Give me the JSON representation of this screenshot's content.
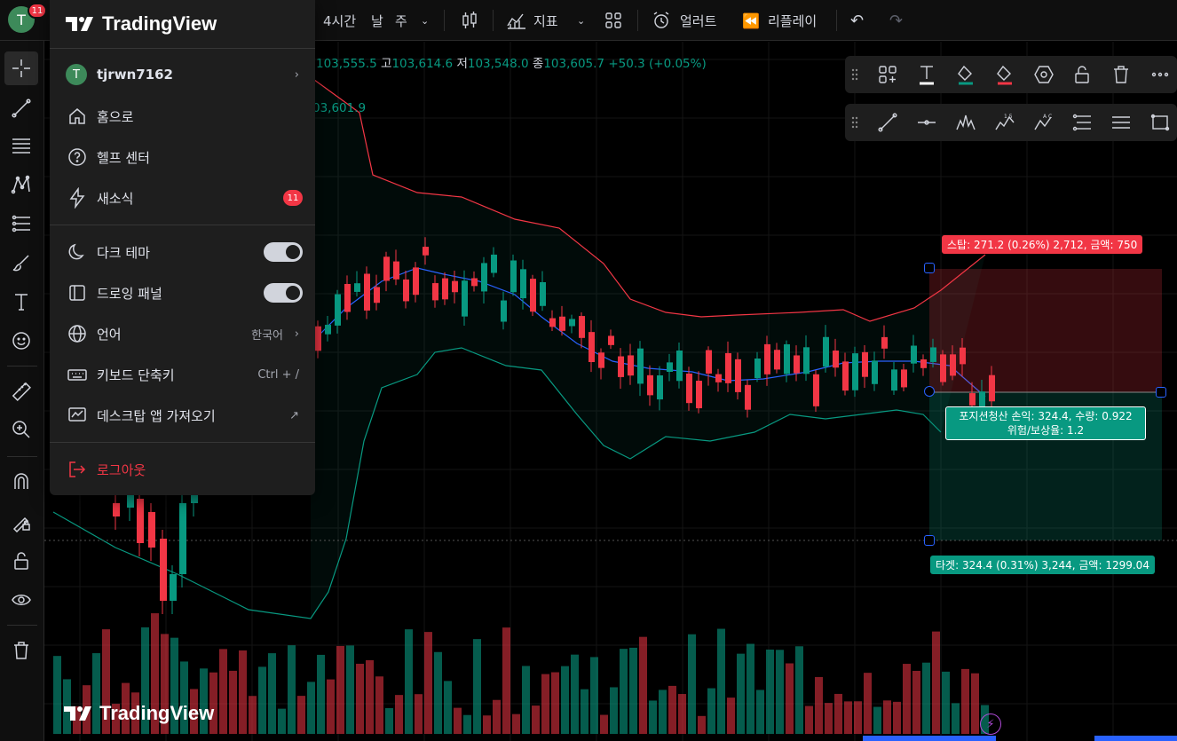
{
  "colors": {
    "up": "#089981",
    "down": "#f23645",
    "accent": "#2962ff",
    "bg": "#000000",
    "panel": "#1e1e1e"
  },
  "avatar": {
    "letter": "T",
    "badge": "11"
  },
  "topbar": {
    "interval": "4시간",
    "period_day": "날",
    "period_week": "주",
    "indicators_label": "지표",
    "alert_label": "얼러트",
    "replay_label": "리플레이"
  },
  "ohlc": {
    "open_value": "103,555.5",
    "high_label": "고",
    "high_value": "103,614.6",
    "low_label": "저",
    "low_value": "103,548.0",
    "close_label": "종",
    "close_value": "103,605.7",
    "change": "+50.3 (+0.05%)"
  },
  "indicator_value": "03,601.9",
  "menu": {
    "brand": "TradingView",
    "username": "tjrwn7162",
    "home": "홈으로",
    "help": "헬프 센터",
    "news": "새소식",
    "news_badge": "11",
    "dark_theme": "다크 테마",
    "drawing_panel": "드로잉 패널",
    "language": "언어",
    "language_value": "한국어",
    "shortcuts": "키보드 단축키",
    "shortcuts_value": "Ctrl + /",
    "desktop_app": "데스크탑 앱 가져오기",
    "logout": "로그아웃"
  },
  "position": {
    "stop_label": "스탑: 271.2 (0.26%) 2,712, 금액: 750",
    "pnl_line1": "포지션청산 손익: 324.4, 수량: 0.922",
    "pnl_line2": "위험/보상율: 1.2",
    "target_label": "타겟: 324.4 (0.31%) 3,244, 금액: 1299.04"
  },
  "watermark": "TradingView"
}
